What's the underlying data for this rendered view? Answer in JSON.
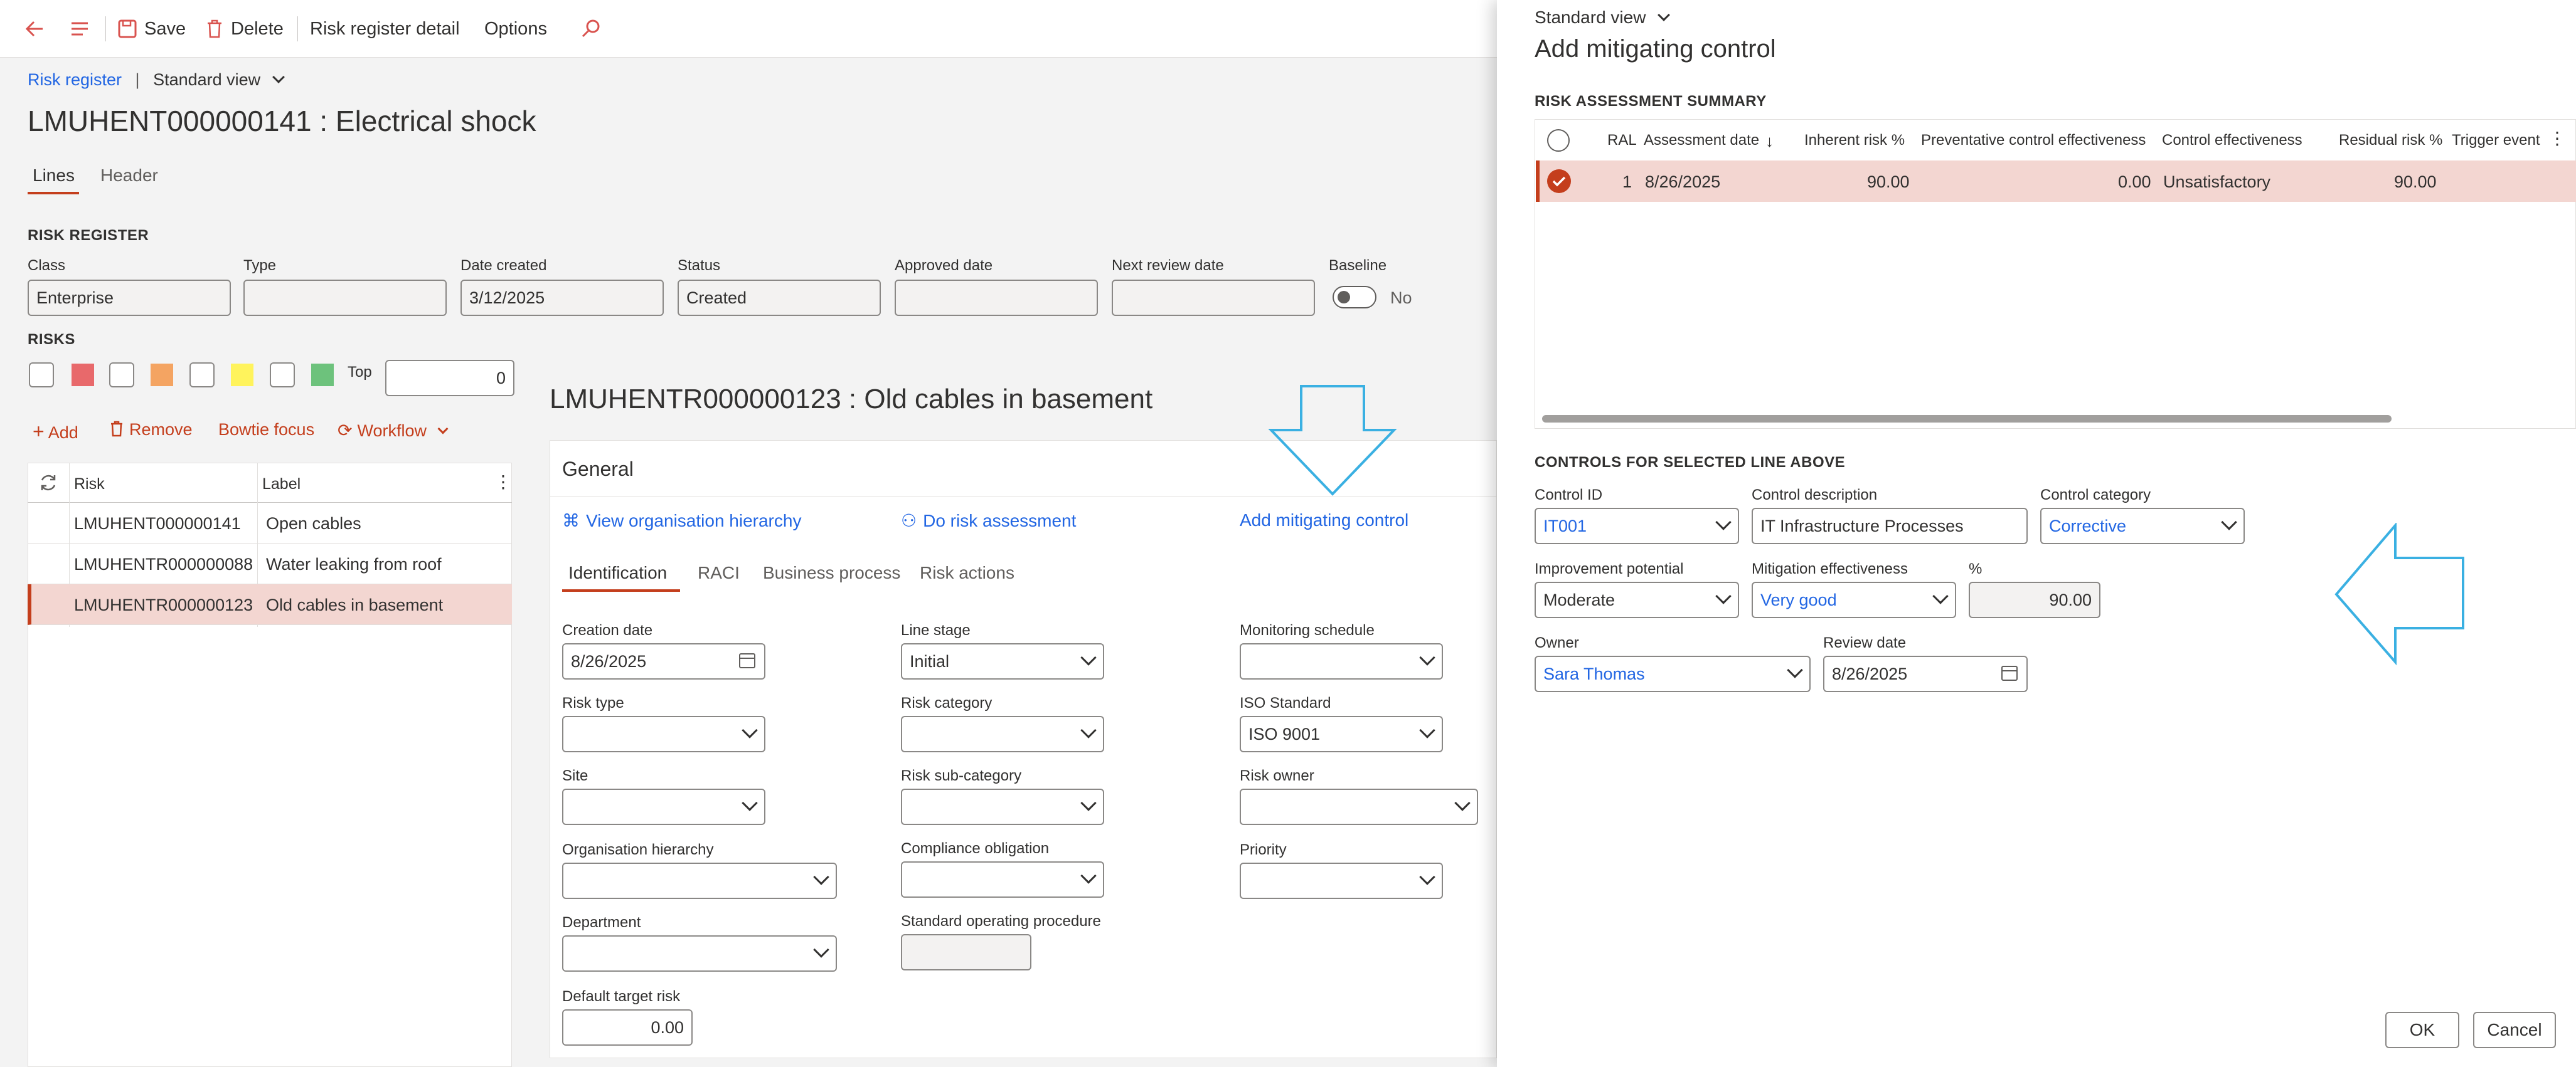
{
  "toolbar": {
    "save": "Save",
    "delete": "Delete",
    "detail": "Risk register detail",
    "options": "Options"
  },
  "breadcrumb": {
    "parent": "Risk register",
    "separator": "|",
    "view": "Standard view"
  },
  "page_title": "LMUHENT000000141 : Electrical shock",
  "tabs": {
    "lines": "Lines",
    "header": "Header"
  },
  "register": {
    "section": "RISK REGISTER",
    "class_label": "Class",
    "class_value": "Enterprise",
    "type_label": "Type",
    "type_value": "",
    "date_label": "Date created",
    "date_value": "3/12/2025",
    "status_label": "Status",
    "status_value": "Created",
    "approved_label": "Approved date",
    "approved_value": "",
    "review_label": "Next review date",
    "review_value": "",
    "baseline_label": "Baseline",
    "baseline_value": "No"
  },
  "risks": {
    "section": "RISKS",
    "top_label": "Top",
    "top_value": "0",
    "swatch_colors": [
      "#e8696b",
      "#f4a462",
      "#fff35c",
      "#6dc27c"
    ],
    "actions": {
      "add": "Add",
      "remove": "Remove",
      "bowtie": "Bowtie focus",
      "workflow": "Workflow"
    },
    "grid": {
      "col_risk": "Risk",
      "col_label": "Label",
      "rows": [
        {
          "risk": "LMUHENT000000141",
          "label": "Open cables"
        },
        {
          "risk": "LMUHENTR000000088",
          "label": "Water leaking from roof"
        },
        {
          "risk": "LMUHENTR000000123",
          "label": "Old cables in basement"
        }
      ]
    }
  },
  "detail": {
    "title": "LMUHENTR000000123 : Old cables in basement",
    "general": "General",
    "links": {
      "hierarchy": "View organisation hierarchy",
      "assessment": "Do risk assessment",
      "mitigating": "Add mitigating control"
    },
    "tabs": {
      "identification": "Identification",
      "raci": "RACI",
      "business": "Business process",
      "actions": "Risk actions"
    },
    "fields": {
      "creation_date_label": "Creation date",
      "creation_date": "8/26/2025",
      "line_stage_label": "Line stage",
      "line_stage": "Initial",
      "monitoring_label": "Monitoring schedule",
      "monitoring": "",
      "risk_type_label": "Risk type",
      "risk_type": "",
      "risk_category_label": "Risk category",
      "risk_category": "",
      "iso_label": "ISO Standard",
      "iso": "ISO 9001",
      "site_label": "Site",
      "site": "",
      "risk_sub_label": "Risk sub-category",
      "risk_sub": "",
      "owner_label": "Risk owner",
      "owner": "",
      "org_label": "Organisation hierarchy",
      "org": "",
      "compliance_label": "Compliance obligation",
      "compliance": "",
      "priority_label": "Priority",
      "priority": "",
      "department_label": "Department",
      "department": "",
      "sop_label": "Standard operating procedure",
      "sop": "",
      "target_label": "Default target risk",
      "target": "0.00"
    }
  },
  "panel": {
    "view": "Standard view",
    "title": "Add mitigating control",
    "summary_section": "RISK ASSESSMENT SUMMARY",
    "columns": {
      "ral": "RAL",
      "date": "Assessment date",
      "inherent": "Inherent risk %",
      "preventative": "Preventative control effectiveness",
      "control": "Control effectiveness",
      "residual": "Residual risk %",
      "trigger": "Trigger event"
    },
    "row": {
      "ral": "1",
      "date": "8/26/2025",
      "inherent": "90.00",
      "preventative": "0.00",
      "control": "Unsatisfactory",
      "residual": "90.00"
    },
    "controls_section": "CONTROLS FOR SELECTED LINE ABOVE",
    "fields": {
      "control_id_label": "Control ID",
      "control_id": "IT001",
      "control_desc_label": "Control description",
      "control_desc": "IT Infrastructure Processes",
      "control_cat_label": "Control category",
      "control_cat": "Corrective",
      "improvement_label": "Improvement potential",
      "improvement": "Moderate",
      "mitigation_label": "Mitigation effectiveness",
      "mitigation": "Very good",
      "percent_label": "%",
      "percent": "90.00",
      "owner_label": "Owner",
      "owner": "Sara Thomas",
      "review_label": "Review date",
      "review": "8/26/2025"
    },
    "ok": "OK",
    "cancel": "Cancel"
  },
  "colors": {
    "accent": "#c43e1c",
    "link": "#2266e3",
    "selected_row": "#f3d6d1",
    "arrow": "#3ab0e2"
  }
}
